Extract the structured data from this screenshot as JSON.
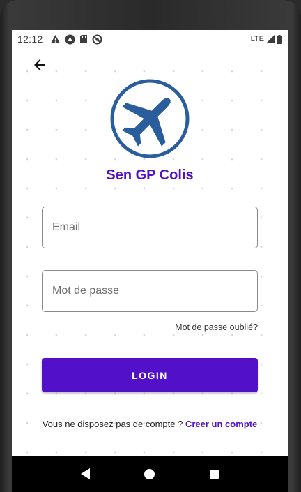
{
  "status_bar": {
    "time": "12:12",
    "network": "LTE",
    "left_icons": [
      "warning-icon",
      "android-icon",
      "sd-card-icon",
      "do-not-disturb-icon"
    ],
    "right_icons": [
      "signal-icon",
      "battery-icon"
    ]
  },
  "app": {
    "title": "Sen GP Colis",
    "logo_icon": "airplane-icon"
  },
  "form": {
    "email_placeholder": "Email",
    "password_placeholder": "Mot de passe",
    "forgot_password": "Mot de passe oublié?",
    "login_label": "LOGIN"
  },
  "signup": {
    "prompt": "Vous ne disposez pas de compte ?",
    "link": "Creer un compte"
  },
  "colors": {
    "accent": "#5211c8",
    "logo": "#2a5d9c"
  }
}
